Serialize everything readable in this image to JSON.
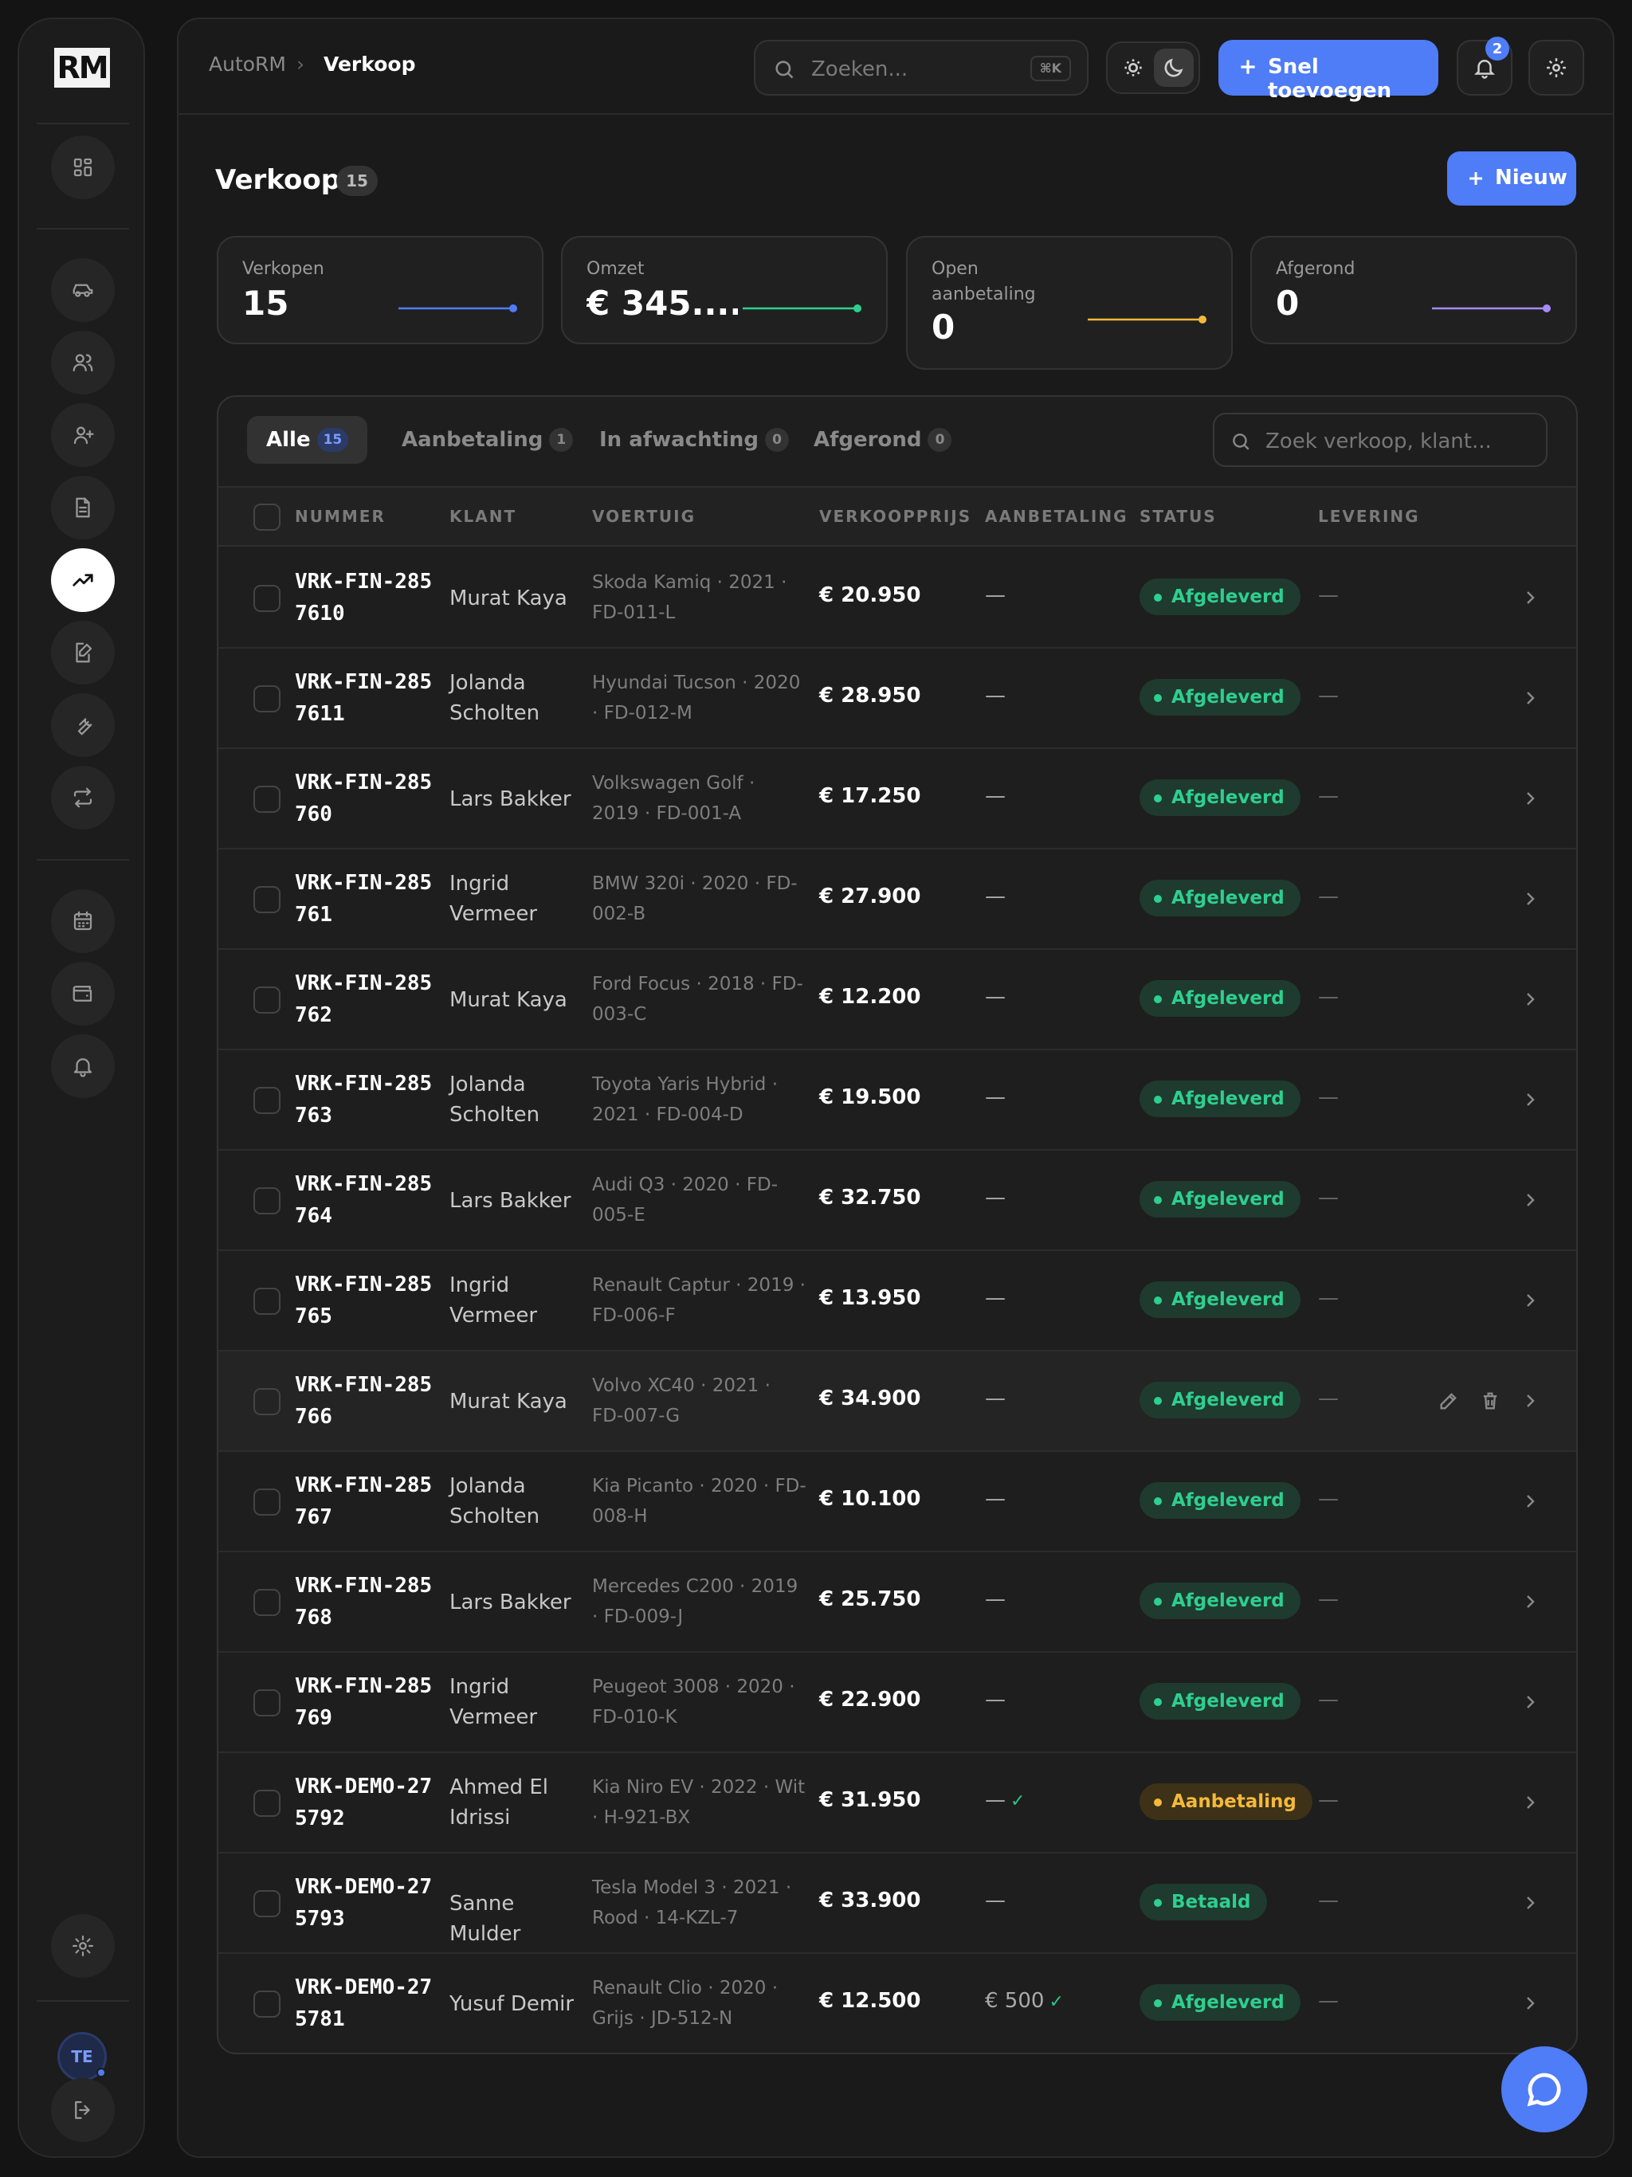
{
  "app": {
    "logo": "RM"
  },
  "breadcrumb": {
    "root": "AutoRM",
    "sep": "›",
    "current": "Verkoop"
  },
  "topbar": {
    "search_placeholder": "Zoeken...",
    "search_kbd": "⌘K",
    "quick_add": "Snel toevoegen",
    "notifications": "2"
  },
  "page": {
    "title": "Verkoop",
    "count": "15",
    "new_label": "Nieuw"
  },
  "stats": [
    {
      "label": "Verkopen",
      "value": "15",
      "color": "#4f7cf7"
    },
    {
      "label": "Omzet",
      "value": "€ 345....",
      "color": "#2ecf8f"
    },
    {
      "label": "Open aanbetaling",
      "value": "0",
      "color": "#f5b93a"
    },
    {
      "label": "Afgerond",
      "value": "0",
      "color": "#a78bfa"
    }
  ],
  "tabs": [
    {
      "label": "Alle",
      "count": "15"
    },
    {
      "label": "Aanbetaling",
      "count": "1"
    },
    {
      "label": "In afwachting",
      "count": "0"
    },
    {
      "label": "Afgerond",
      "count": "0"
    }
  ],
  "table_search_placeholder": "Zoek verkoop, klant...",
  "columns": [
    "NUMMER",
    "KLANT",
    "VOERTUIG",
    "VERKOOPPRIJS",
    "AANBETALING",
    "STATUS",
    "LEVERING"
  ],
  "rows": [
    {
      "num": "VRK-FIN-2857610",
      "klant": "Murat Kaya",
      "veh": "Skoda Kamiq · 2021 · FD-011-L",
      "price": "€ 20.950",
      "aanb": "—",
      "aanb_check": "",
      "status": "Afgeleverd",
      "tone": "green",
      "lev": "—"
    },
    {
      "num": "VRK-FIN-2857611",
      "klant": "Jolanda Scholten",
      "veh": "Hyundai Tucson · 2020 · FD-012-M",
      "price": "€ 28.950",
      "aanb": "—",
      "aanb_check": "",
      "status": "Afgeleverd",
      "tone": "green",
      "lev": "—"
    },
    {
      "num": "VRK-FIN-285760",
      "klant": "Lars Bakker",
      "veh": "Volkswagen Golf · 2019 · FD-001-A",
      "price": "€ 17.250",
      "aanb": "—",
      "aanb_check": "",
      "status": "Afgeleverd",
      "tone": "green",
      "lev": "—"
    },
    {
      "num": "VRK-FIN-285761",
      "klant": "Ingrid Vermeer",
      "veh": "BMW 320i · 2020 · FD-002-B",
      "price": "€ 27.900",
      "aanb": "—",
      "aanb_check": "",
      "status": "Afgeleverd",
      "tone": "green",
      "lev": "—"
    },
    {
      "num": "VRK-FIN-285762",
      "klant": "Murat Kaya",
      "veh": "Ford Focus · 2018 · FD-003-C",
      "price": "€ 12.200",
      "aanb": "—",
      "aanb_check": "",
      "status": "Afgeleverd",
      "tone": "green",
      "lev": "—"
    },
    {
      "num": "VRK-FIN-285763",
      "klant": "Jolanda Scholten",
      "veh": "Toyota Yaris Hybrid · 2021 · FD-004-D",
      "price": "€ 19.500",
      "aanb": "—",
      "aanb_check": "",
      "status": "Afgeleverd",
      "tone": "green",
      "lev": "—"
    },
    {
      "num": "VRK-FIN-285764",
      "klant": "Lars Bakker",
      "veh": "Audi Q3 · 2020 · FD-005-E",
      "price": "€ 32.750",
      "aanb": "—",
      "aanb_check": "",
      "status": "Afgeleverd",
      "tone": "green",
      "lev": "—"
    },
    {
      "num": "VRK-FIN-285765",
      "klant": "Ingrid Vermeer",
      "veh": "Renault Captur · 2019 · FD-006-F",
      "price": "€ 13.950",
      "aanb": "—",
      "aanb_check": "",
      "status": "Afgeleverd",
      "tone": "green",
      "lev": "—"
    },
    {
      "num": "VRK-FIN-285766",
      "klant": "Murat Kaya",
      "veh": "Volvo XC40 · 2021 · FD-007-G",
      "price": "€ 34.900",
      "aanb": "—",
      "aanb_check": "",
      "status": "Afgeleverd",
      "tone": "green",
      "lev": "—",
      "hover": true
    },
    {
      "num": "VRK-FIN-285767",
      "klant": "Jolanda Scholten",
      "veh": "Kia Picanto · 2020 · FD-008-H",
      "price": "€ 10.100",
      "aanb": "—",
      "aanb_check": "",
      "status": "Afgeleverd",
      "tone": "green",
      "lev": "—"
    },
    {
      "num": "VRK-FIN-285768",
      "klant": "Lars Bakker",
      "veh": "Mercedes C200 · 2019 · FD-009-J",
      "price": "€ 25.750",
      "aanb": "—",
      "aanb_check": "",
      "status": "Afgeleverd",
      "tone": "green",
      "lev": "—"
    },
    {
      "num": "VRK-FIN-285769",
      "klant": "Ingrid Vermeer",
      "veh": "Peugeot 3008 · 2020 · FD-010-K",
      "price": "€ 22.900",
      "aanb": "—",
      "aanb_check": "",
      "status": "Afgeleverd",
      "tone": "green",
      "lev": "—"
    },
    {
      "num": "VRK-DEMO-275792",
      "klant": "Ahmed El Idrissi",
      "veh": "Kia Niro EV · 2022 · Wit · H-921-BX",
      "price": "€ 31.950",
      "aanb": "—",
      "aanb_check": "✓",
      "status": "Aanbetaling",
      "tone": "amber",
      "lev": "—"
    },
    {
      "num": "VRK-DEMO-275793",
      "klant": "Sanne Mulder",
      "veh": "Tesla Model 3 · 2021 · Rood · 14-KZL-7",
      "price": "€ 33.900",
      "aanb": "—",
      "aanb_check": "",
      "status": "Betaald",
      "tone": "green",
      "lev": "—"
    },
    {
      "num": "VRK-DEMO-275781",
      "klant": "Yusuf Demir",
      "veh": "Renault Clio · 2020 · Grijs · JD-512-N",
      "price": "€ 12.500",
      "aanb": "€ 500",
      "aanb_check": "✓",
      "status": "Afgeleverd",
      "tone": "green",
      "lev": "—"
    }
  ],
  "user": {
    "initials": "TE"
  },
  "colors": {
    "accent": "#4f7cf7",
    "success": "#2ecf8f",
    "warning": "#f5b93a"
  }
}
